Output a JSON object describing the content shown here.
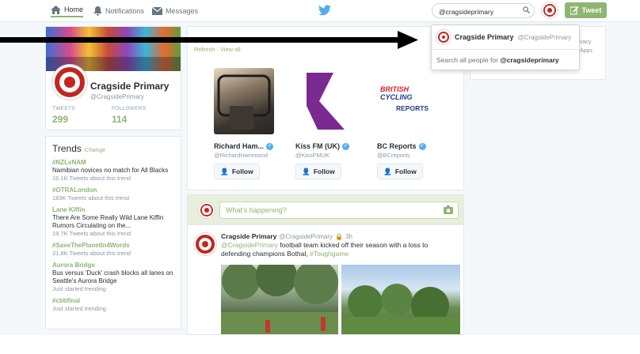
{
  "nav": {
    "home": "Home",
    "notifications": "Notifications",
    "messages": "Messages"
  },
  "search": {
    "value": "@cragsideprimary"
  },
  "tweet_button": "Tweet",
  "profile": {
    "name": "Cragside Primary",
    "handle": "@CragsidePrimary",
    "tweets_label": "TWEETS",
    "tweets_value": "299",
    "followers_label": "FOLLOWERS",
    "followers_value": "114"
  },
  "trends": {
    "title": "Trends",
    "change": "Change",
    "items": [
      {
        "name": "#NZLvNAM",
        "desc": "Namibian novices no match for All Blacks",
        "meta": "16.1K Tweets about this trend"
      },
      {
        "name": "#OTRALondon",
        "desc": "",
        "meta": "183K Tweets about this trend"
      },
      {
        "name": "Lane Kiffin",
        "desc": "There Are Some Really Wild Lane Kiffin Rumors Circulating on the...",
        "meta": "19.7K Tweets about this trend"
      },
      {
        "name": "#SaveThePlanetIn4Words",
        "desc": "",
        "meta": "31.8K Tweets about this trend"
      },
      {
        "name": "Aurora Bridge",
        "desc": "Bus versus 'Duck' crash blocks all lanes on Seattle's Aurora Bridge",
        "meta": "Just started trending"
      },
      {
        "name": "#cbbfinal",
        "desc": "",
        "meta": "Just started trending"
      }
    ]
  },
  "who_to_follow": {
    "refresh": "Refresh",
    "separator": "·",
    "view_all": "View all",
    "follow_label": "Follow",
    "suggestions": [
      {
        "name": "Richard Ham...",
        "handle": "@RichardHammond"
      },
      {
        "name": "Kiss FM (UK)",
        "handle": "@KissFMUK"
      },
      {
        "name": "BC Reports",
        "handle": "@BCreports"
      }
    ],
    "bc_logo": {
      "line1": "BRITISH",
      "line2": "CYCLING",
      "line3": "REPORTS"
    }
  },
  "compose": {
    "placeholder": "What's happening?"
  },
  "tweet": {
    "author": "Cragside Primary",
    "handle": "@CragsidePrimary",
    "time": "3h",
    "mention": "@CragsidePrimary",
    "text": " football team kicked off their season with a loss to defending champions Bothal, ",
    "hashtag": "#Toughgame"
  },
  "dropdown": {
    "name": "Cragside Primary",
    "handle": "@CragsidePrimary",
    "search_all_prefix": "Search all people for ",
    "search_all_query": "@cragsideprimary"
  },
  "right_card": {
    "line1": "vacy",
    "line2": "Apps"
  },
  "colors": {
    "accent": "#8eb573",
    "brand_red": "#c2261f",
    "link_blue": "#55acee"
  }
}
